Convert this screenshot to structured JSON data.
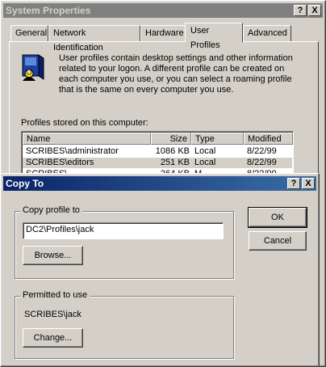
{
  "system_properties": {
    "title": "System Properties",
    "title_buttons": {
      "help": "?",
      "close": "X"
    },
    "tabs": [
      {
        "label": "General"
      },
      {
        "label": "Network Identification"
      },
      {
        "label": "Hardware"
      },
      {
        "label": "User Profiles"
      },
      {
        "label": "Advanced"
      }
    ],
    "active_tab": "User Profiles",
    "description": "User profiles contain desktop settings and other information related to your logon.  A different profile can be created on each computer you use, or you can select a roaming profile that is the same on every computer you use.",
    "profiles_label": "Profiles stored on this computer:",
    "columns": [
      "Name",
      "Size",
      "Type",
      "Modified"
    ],
    "rows": [
      {
        "name": "SCRIBES\\administrator",
        "size": "1086 KB",
        "type": "Local",
        "modified": "8/22/99"
      },
      {
        "name": "SCRIBES\\editors",
        "size": "251 KB",
        "type": "Local",
        "modified": "8/22/99"
      },
      {
        "name": "SCRIBES\\...",
        "size": "264 KB",
        "type": "M...",
        "modified": "8/22/99"
      }
    ]
  },
  "copy_to": {
    "title": "Copy To",
    "title_buttons": {
      "help": "?",
      "close": "X"
    },
    "copy_profile_label": "Copy profile to",
    "copy_profile_value": "DC2\\Profiles\\jack",
    "browse_label": "Browse...",
    "permitted_label": "Permitted to use",
    "permitted_user": "SCRIBES\\jack",
    "change_label": "Change...",
    "ok_label": "OK",
    "cancel_label": "Cancel"
  },
  "colors": {
    "dialog_face": "#d4d0c8",
    "active_title": "#0a246a",
    "inactive_title": "#808080"
  }
}
